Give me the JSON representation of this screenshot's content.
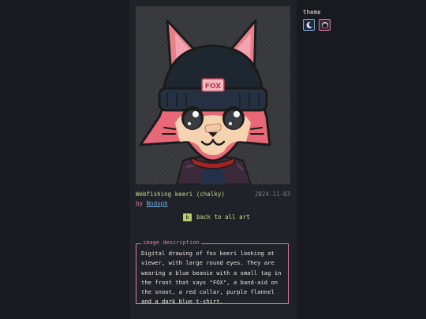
{
  "artwork": {
    "title": "Webfishing keeri (chalky)",
    "date": "2024-11-03",
    "by_prefix": "by",
    "author": "Nodoph",
    "beanie_tag_text": "FOX"
  },
  "navigation": {
    "back_key": "b",
    "back_label": "back to all art"
  },
  "description": {
    "legend": "image description",
    "text": "Digital drawing of fox keeri looking at viewer, with large round eyes. They are wearing a blue beanie with a small tag in the front that says \"FOX\", a band-aid on the snoot, a red collar, purple flannel and a dark blue t-shirt."
  },
  "theme": {
    "label": "theme",
    "options": [
      {
        "icon": "moon-icon",
        "color": "#7fb0e0"
      },
      {
        "icon": "circle-icon",
        "color": "#e07aa8"
      }
    ]
  },
  "colors": {
    "background": "#181a20",
    "panel": "#1f2229",
    "accent_green": "#c7d98a",
    "accent_pink": "#e07aa8",
    "link_blue": "#6fb3e0",
    "muted": "#7c7f86"
  }
}
